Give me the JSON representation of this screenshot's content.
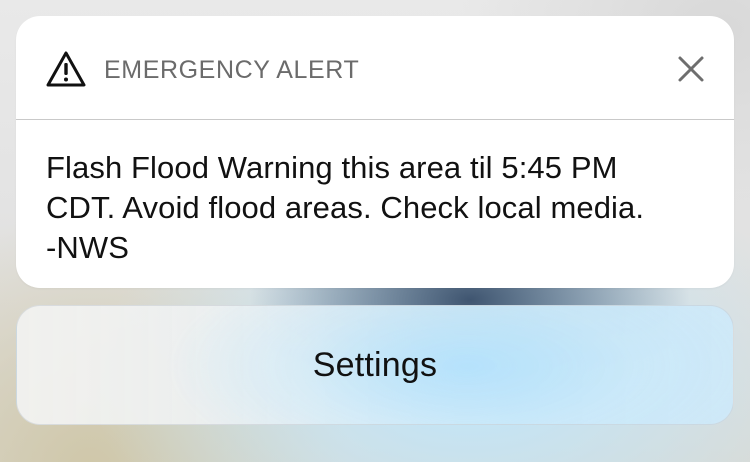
{
  "alert": {
    "header_title": "EMERGENCY ALERT",
    "icon": "warning-triangle-icon",
    "close_icon": "close-icon",
    "message": "Flash Flood Warning this area til 5:45 PM CDT. Avoid flood areas. Check local media. -NWS"
  },
  "actions": {
    "settings_label": "Settings"
  }
}
